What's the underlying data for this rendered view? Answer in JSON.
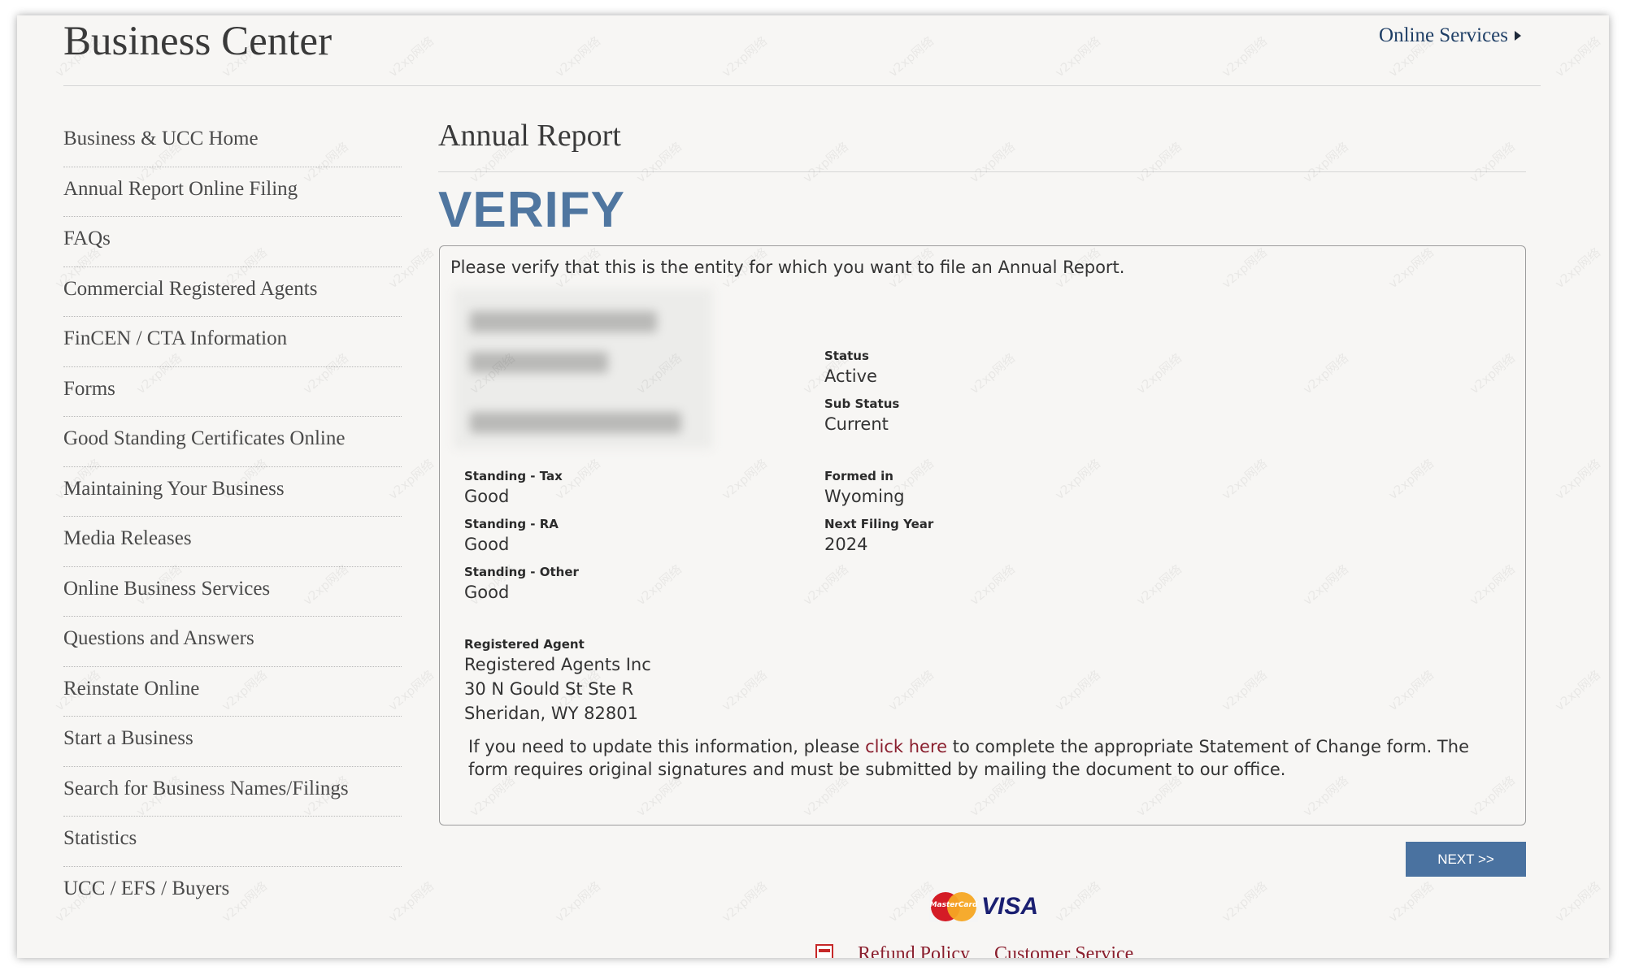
{
  "header": {
    "site_title": "Business Center",
    "online_services_label": "Online Services"
  },
  "sidebar": {
    "items": [
      {
        "label": "Business & UCC Home"
      },
      {
        "label": "Annual Report Online Filing"
      },
      {
        "label": "FAQs"
      },
      {
        "label": "Commercial Registered Agents"
      },
      {
        "label": "FinCEN / CTA Information"
      },
      {
        "label": "Forms"
      },
      {
        "label": "Good Standing Certificates Online"
      },
      {
        "label": "Maintaining Your Business"
      },
      {
        "label": "Media Releases"
      },
      {
        "label": "Online Business Services"
      },
      {
        "label": "Questions and Answers"
      },
      {
        "label": "Reinstate Online"
      },
      {
        "label": "Start a Business"
      },
      {
        "label": "Search for Business Names/Filings"
      },
      {
        "label": "Statistics"
      },
      {
        "label": "UCC / EFS / Buyers"
      }
    ]
  },
  "main": {
    "page_heading": "Annual Report",
    "verify_title": "VERIFY",
    "intro": "Please verify that this is the entity for which you want to file an Annual Report.",
    "status": {
      "label": "Status",
      "value": "Active"
    },
    "sub_status": {
      "label": "Sub Status",
      "value": "Current"
    },
    "standing_tax": {
      "label": "Standing - Tax",
      "value": "Good"
    },
    "standing_ra": {
      "label": "Standing - RA",
      "value": "Good"
    },
    "standing_other": {
      "label": "Standing - Other",
      "value": "Good"
    },
    "formed_in": {
      "label": "Formed in",
      "value": "Wyoming"
    },
    "next_filing_year": {
      "label": "Next Filing Year",
      "value": "2024"
    },
    "registered_agent": {
      "label": "Registered Agent",
      "name": "Registered Agents Inc",
      "address_line1": "30 N Gould St Ste R",
      "address_line2": "Sheridan, WY 82801"
    },
    "change_note": {
      "before": "If you need to update this information, please ",
      "link": "click here",
      "after": " to complete the appropriate Statement of Change form. The form requires original signatures and must be submitted by mailing the document to our office."
    },
    "next_button": "NEXT >>"
  },
  "payment": {
    "mastercard_text": "MasterCard",
    "visa_text": "VISA"
  },
  "footer": {
    "refund_policy": "Refund Policy",
    "customer_service": "Customer Service"
  },
  "watermark_text": "v2xp网络"
}
